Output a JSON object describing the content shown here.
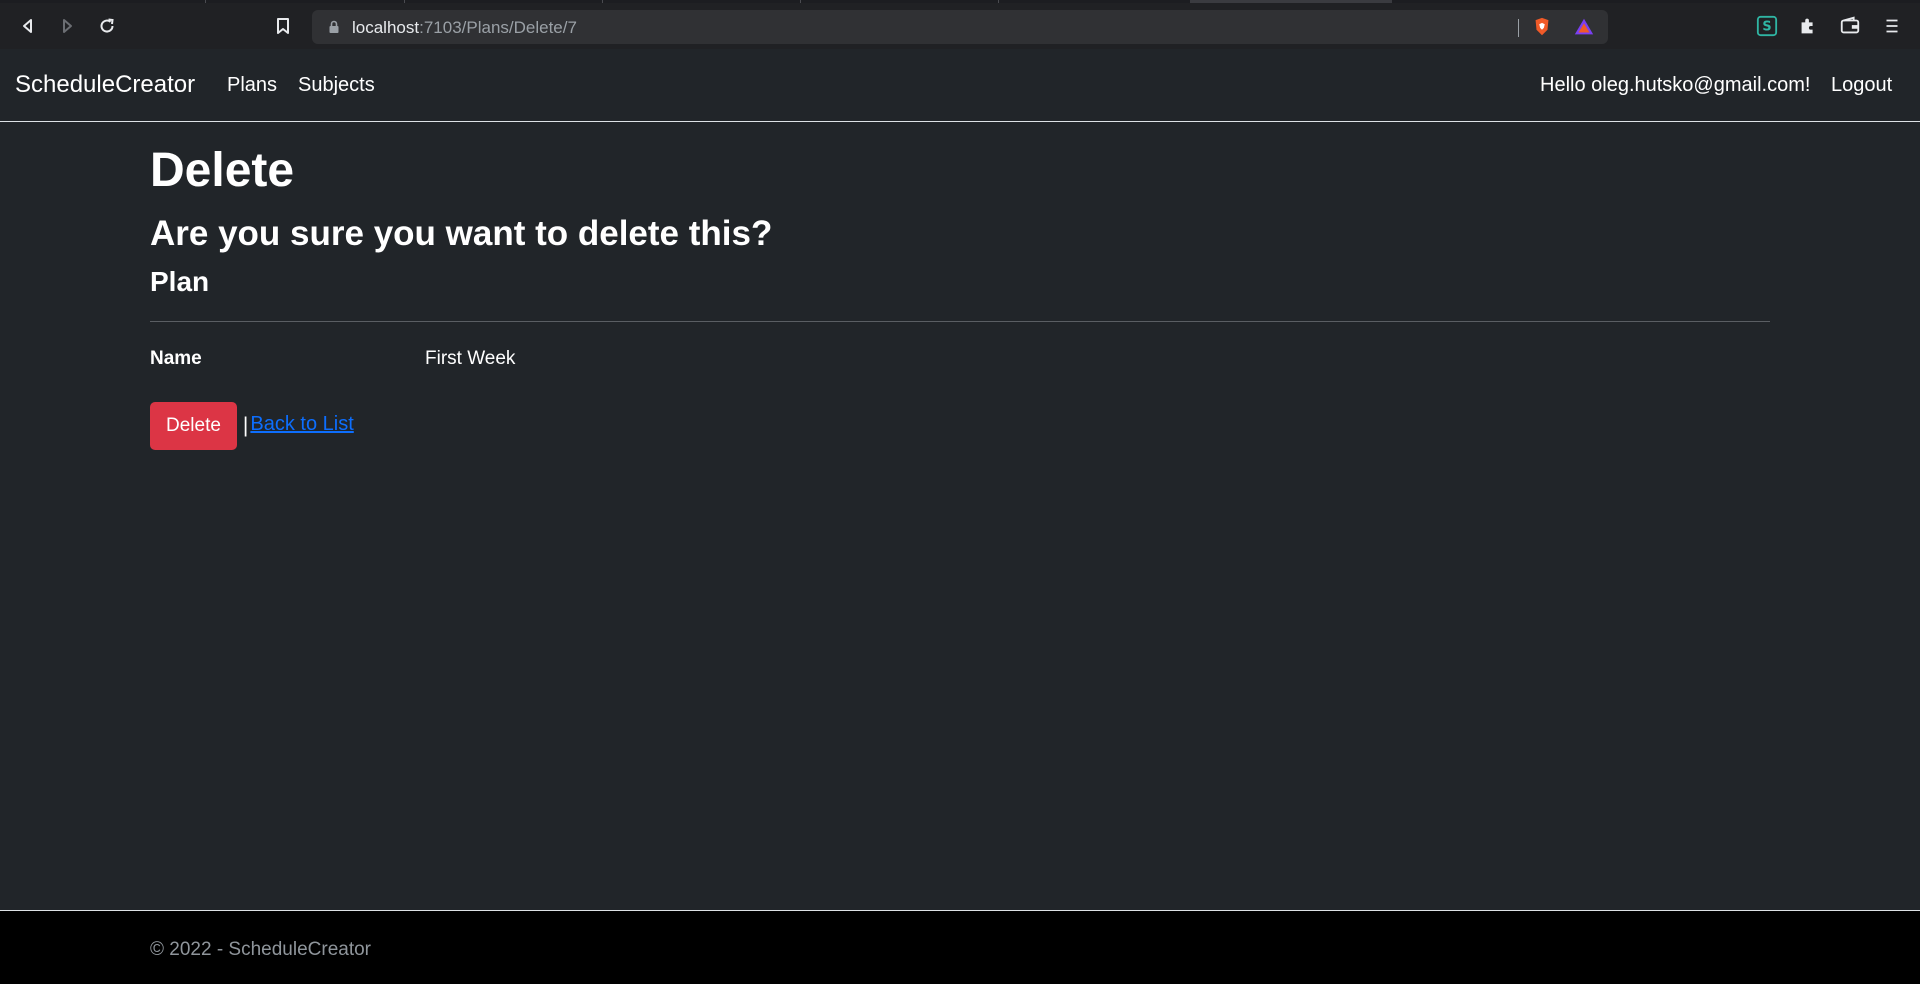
{
  "browser": {
    "url_host": "localhost",
    "url_path": ":7103/Plans/Delete/7"
  },
  "navbar": {
    "brand": "ScheduleCreator",
    "links": [
      "Plans",
      "Subjects"
    ],
    "greeting": "Hello oleg.hutsko@gmail.com!",
    "logout": "Logout"
  },
  "main": {
    "title": "Delete",
    "confirm_text": "Are you sure you want to delete this?",
    "entity_type": "Plan",
    "fields": [
      {
        "label": "Name",
        "value": "First Week"
      }
    ],
    "delete_button": "Delete",
    "separator": "|",
    "back_link": "Back to List"
  },
  "footer": {
    "text": "© 2022 - ScheduleCreator"
  },
  "colors": {
    "background": "#212529",
    "danger": "#dc3545",
    "link": "#0d6efd",
    "footer_bg": "#000000"
  }
}
